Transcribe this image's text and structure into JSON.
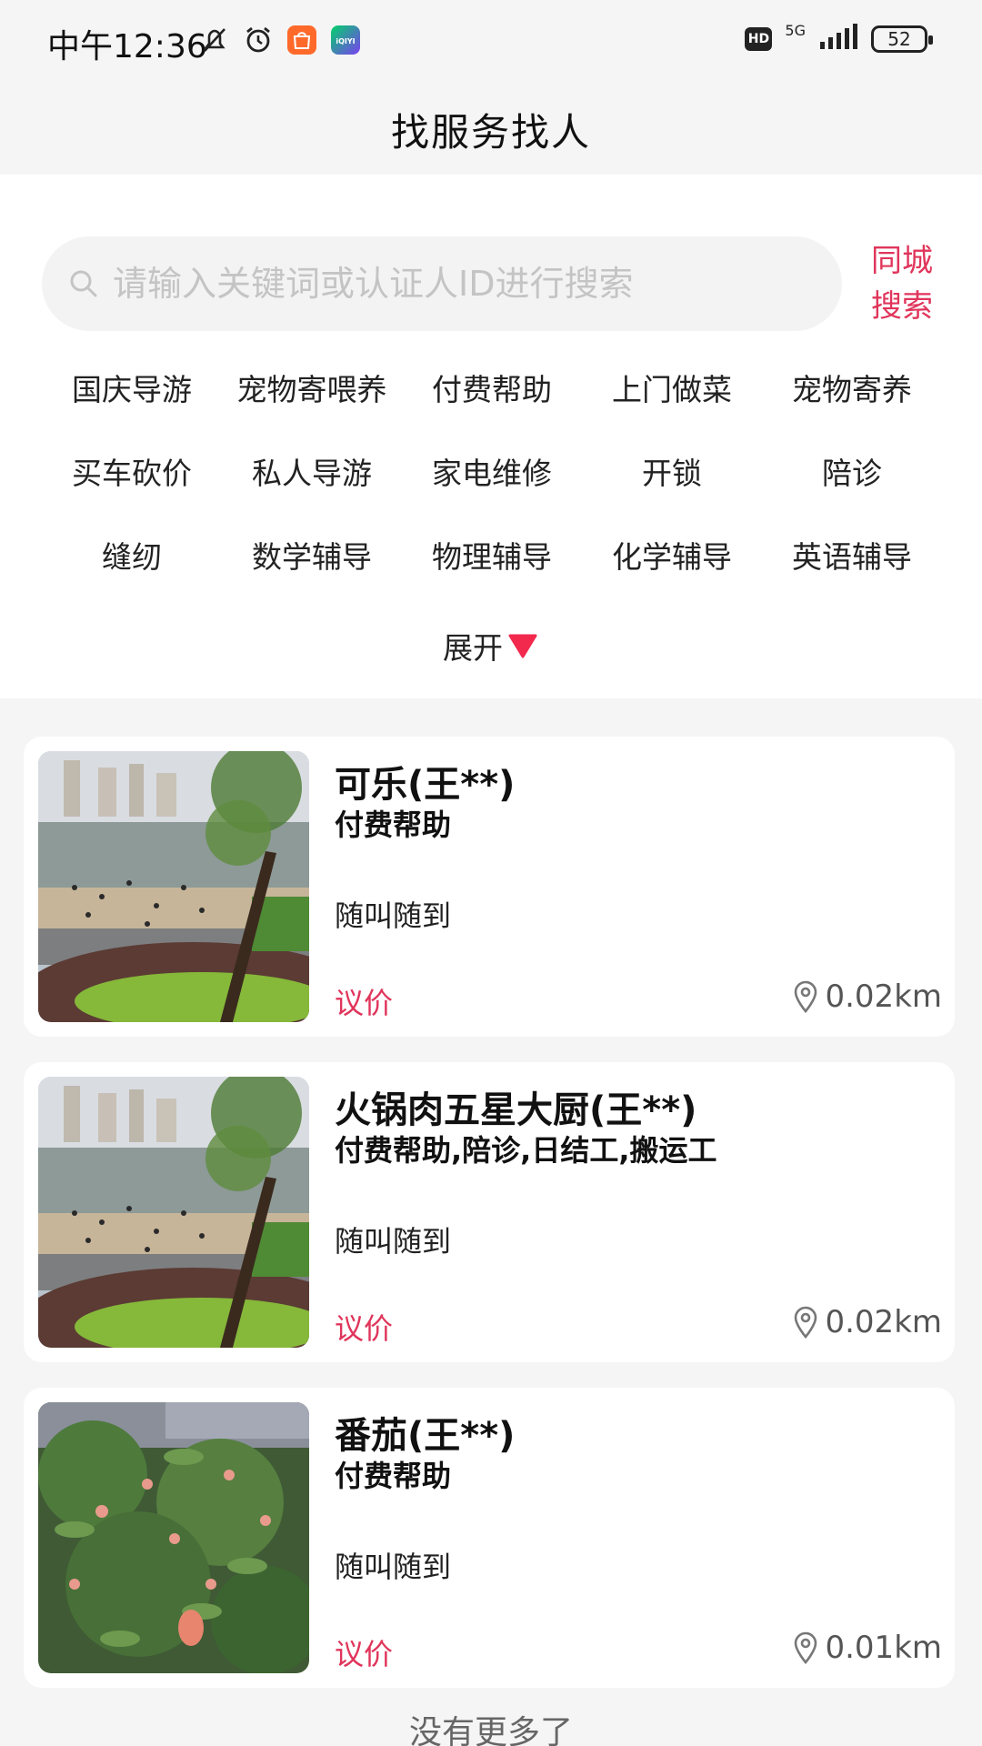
{
  "status_bar": {
    "time": "中午12:36",
    "network": "5G",
    "hd": "HD",
    "battery": "52",
    "app1_label": "mi",
    "app2_label": "iQIYI"
  },
  "header": {
    "title": "找服务找人"
  },
  "search": {
    "placeholder": "请输入关键词或认证人ID进行搜索",
    "city_search_line1": "同城",
    "city_search_line2": "搜索"
  },
  "categories": [
    "国庆导游",
    "宠物寄喂养",
    "付费帮助",
    "上门做菜",
    "宠物寄养",
    "买车砍价",
    "私人导游",
    "家电维修",
    "开锁",
    "陪诊",
    "缝纫",
    "数学辅导",
    "物理辅导",
    "化学辅导",
    "英语辅导"
  ],
  "expand_label": "展开",
  "listings": [
    {
      "name": "可乐(王**)",
      "tags": "付费帮助",
      "note": "随叫随到",
      "price": "议价",
      "distance": "0.02km"
    },
    {
      "name": "火锅肉五星大厨(王**)",
      "tags": "付费帮助,陪诊,日结工,搬运工",
      "note": "随叫随到",
      "price": "议价",
      "distance": "0.02km"
    },
    {
      "name": "番茄(王**)",
      "tags": "付费帮助",
      "note": "随叫随到",
      "price": "议价",
      "distance": "0.01km"
    }
  ],
  "footer": {
    "no_more": "没有更多了"
  },
  "colors": {
    "accent": "#e0355b",
    "page_bg": "#f5f5f5",
    "card_bg": "#ffffff"
  }
}
